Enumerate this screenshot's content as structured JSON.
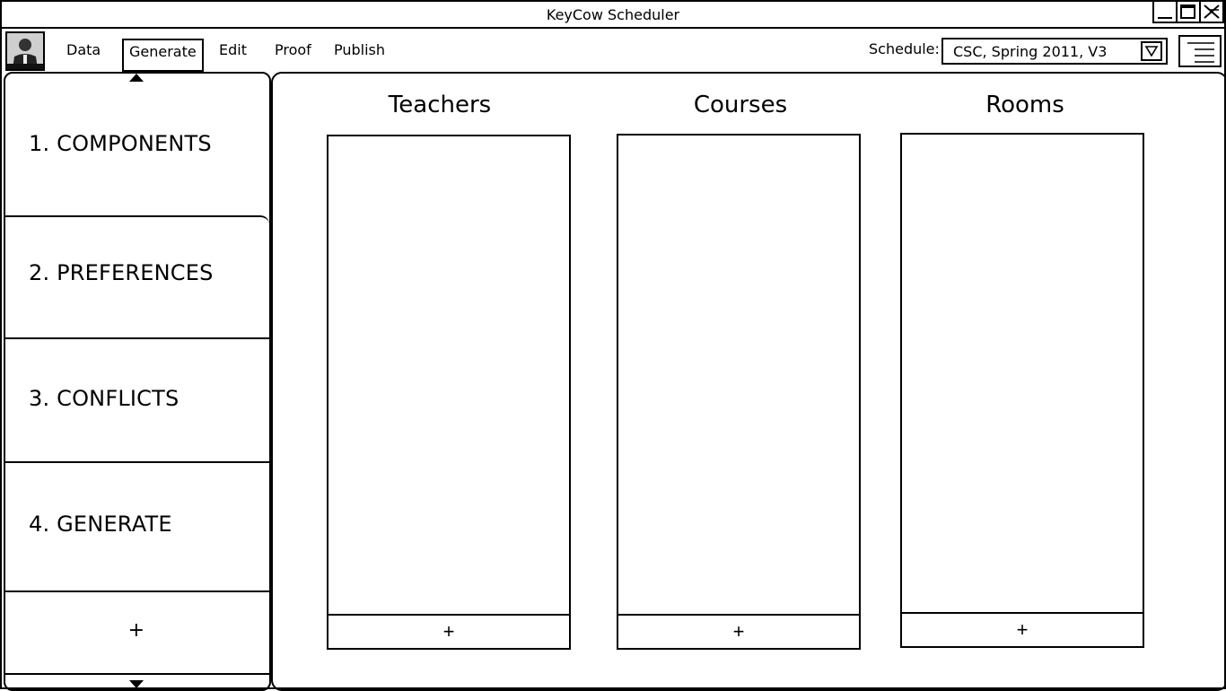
{
  "window": {
    "title": "KeyCow Scheduler"
  },
  "menu": {
    "items": [
      "Data",
      "Generate",
      "Edit",
      "Proof",
      "Publish"
    ],
    "active": "Generate"
  },
  "schedule": {
    "label": "Schedule:",
    "value": "CSC, Spring 2011, V3"
  },
  "sidebar": {
    "steps": [
      {
        "label": "1. COMPONENTS"
      },
      {
        "label": "2. PREFERENCES"
      },
      {
        "label": "3. CONFLICTS"
      },
      {
        "label": "4. GENERATE"
      }
    ],
    "add_label": "+"
  },
  "main": {
    "columns": [
      {
        "title": "Teachers",
        "add_label": "+"
      },
      {
        "title": "Courses",
        "add_label": "+"
      },
      {
        "title": "Rooms",
        "add_label": "+"
      }
    ]
  },
  "icons": {
    "minimize": "minimize-icon",
    "maximize": "maximize-icon",
    "close": "close-icon",
    "dropdown": "triangle-down-icon",
    "menu": "hamburger-menu-icon",
    "scroll_up": "triangle-up-icon",
    "scroll_down": "triangle-down-icon"
  }
}
